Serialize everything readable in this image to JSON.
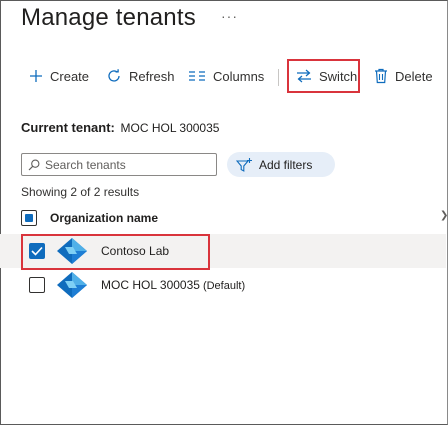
{
  "page": {
    "title": "Manage tenants",
    "more_label": "···"
  },
  "toolbar": {
    "create_label": "Create",
    "refresh_label": "Refresh",
    "columns_label": "Columns",
    "switch_label": "Switch",
    "delete_label": "Delete"
  },
  "current_tenant": {
    "label": "Current tenant:",
    "value": "MOC HOL 300035"
  },
  "search": {
    "placeholder": "Search tenants",
    "value": ""
  },
  "filters": {
    "add_label": "Add filters"
  },
  "results": {
    "summary": "Showing 2 of 2 results"
  },
  "table": {
    "column_header": "Organization name",
    "rows": [
      {
        "name": "Contoso Lab",
        "default_tag": "",
        "checked": true
      },
      {
        "name": "MOC HOL 300035",
        "default_tag": "(Default)",
        "checked": false
      }
    ]
  },
  "colors": {
    "accent": "#0f6cbd",
    "highlight": "#d9343c",
    "filter_pill_bg": "#e6eef8"
  },
  "icons": {
    "create": "plus-icon",
    "refresh": "refresh-icon",
    "columns": "columns-icon",
    "switch": "switch-arrows-icon",
    "delete": "trash-icon",
    "search": "search-icon",
    "filter": "filter-add-icon",
    "tenant": "azure-ad-b2c-icon"
  }
}
